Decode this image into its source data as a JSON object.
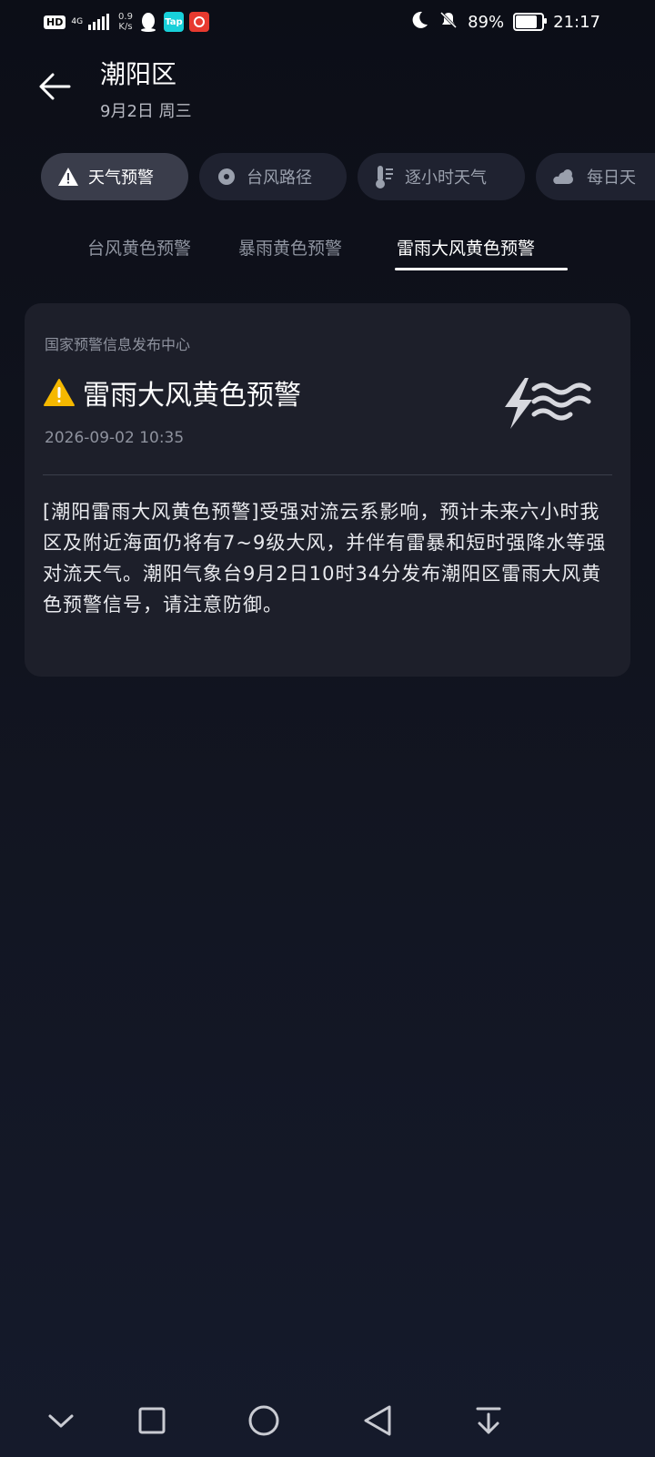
{
  "status_bar": {
    "hd": "HD",
    "network": "4G",
    "speed_value": "0.9",
    "speed_unit": "K/s",
    "app_tap_label": "Tap",
    "battery_percent": "89%",
    "battery_level": 0.89,
    "time": "21:17"
  },
  "header": {
    "title": "潮阳区",
    "subtitle": "9月2日 周三"
  },
  "chips": [
    {
      "label": "天气预警",
      "icon": "warning-icon",
      "active": true
    },
    {
      "label": "台风路径",
      "icon": "typhoon-icon",
      "active": false
    },
    {
      "label": "逐小时天气",
      "icon": "thermometer-icon",
      "active": false
    },
    {
      "label": "每日天",
      "icon": "partly-cloudy-icon",
      "active": false
    }
  ],
  "subtabs": [
    {
      "label": "台风黄色预警",
      "active": false
    },
    {
      "label": "暴雨黄色预警",
      "active": false
    },
    {
      "label": "雷雨大风黄色预警",
      "active": true
    }
  ],
  "card": {
    "source": "国家预警信息发布中心",
    "title": "雷雨大风黄色预警",
    "timestamp": "2026-09-02 10:35",
    "body": "[潮阳雷雨大风黄色预警]受强对流云系影响，预计未来六小时我区及附近海面仍将有7~9级大风，并伴有雷暴和短时强降水等强对流天气。潮阳气象台9月2日10时34分发布潮阳区雷雨大风黄色预警信号，请注意防御。",
    "warning_color": "#f5b800"
  },
  "nav": [
    "collapse-icon",
    "recents-icon",
    "home-icon",
    "back-icon",
    "notification-pull-icon"
  ]
}
